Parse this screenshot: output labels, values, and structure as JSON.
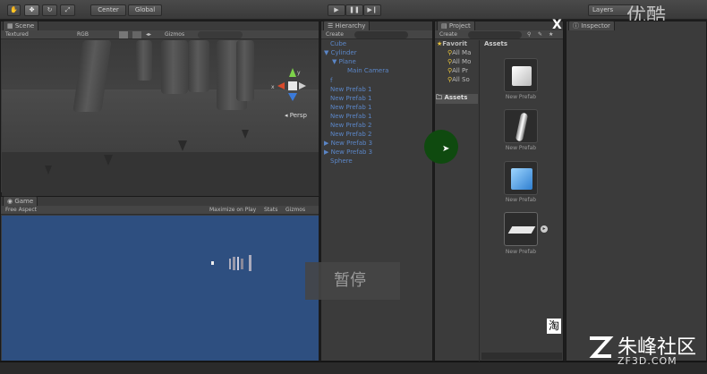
{
  "toolbar": {
    "pivot_label": "Center",
    "global_label": "Global",
    "layers_label": "Layers"
  },
  "scene": {
    "tab": "Scene",
    "shading": "Textured",
    "render_mode": "RGB",
    "gizmos": "Gizmos",
    "persp": "Persp",
    "axis_x": "x",
    "axis_y": "y"
  },
  "game": {
    "tab": "Game",
    "aspect": "Free Aspect",
    "maximize": "Maximize on Play",
    "stats": "Stats",
    "gizmos": "Gizmos"
  },
  "hierarchy": {
    "tab": "Hierarchy",
    "create": "Create",
    "items": [
      "Cube",
      "Cylinder",
      "Plane",
      "Main Camera",
      "f",
      "New Prefab 1",
      "New Prefab 1",
      "New Prefab 1",
      "New Prefab 1",
      "New Prefab 2",
      "New Prefab 2",
      "New Prefab 3",
      "New Prefab 3",
      "Sphere"
    ]
  },
  "project": {
    "tab": "Project",
    "create": "Create",
    "favorites": "Favorit",
    "fav_items": [
      "All Ma",
      "All Mo",
      "All Pr",
      "All So"
    ],
    "assets_folder": "Assets",
    "assets_header": "Assets",
    "assets": [
      "New Prefab",
      "New Prefab",
      "New Prefab",
      "New Prefab"
    ]
  },
  "inspector": {
    "tab": "Inspector"
  },
  "overlay": {
    "pause_text": "暂停",
    "close": "X",
    "ime_char": "淘",
    "watermark_youku": "优酷",
    "watermark_cn": "朱峰社区",
    "watermark_en": "ZF3D.COM"
  },
  "colors": {
    "hierarchy_text": "#5b86c7",
    "game_bg": "#2e4f80",
    "cursor_highlight": "#0f4a0f"
  }
}
